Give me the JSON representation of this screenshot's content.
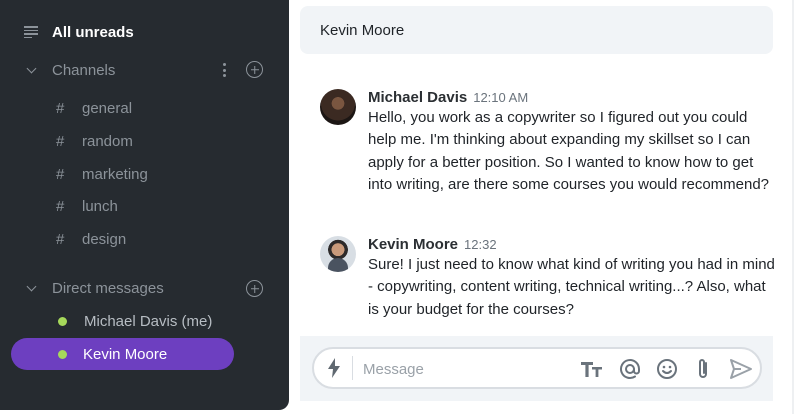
{
  "sidebar": {
    "all_unreads": "All unreads",
    "channels_header": "Channels",
    "channels": [
      {
        "label": "general"
      },
      {
        "label": "random"
      },
      {
        "label": "marketing"
      },
      {
        "label": "lunch"
      },
      {
        "label": "design"
      }
    ],
    "dm_header": "Direct messages",
    "direct_messages": [
      {
        "label": "Michael Davis (me)",
        "status": "online"
      },
      {
        "label": "Kevin Moore",
        "status": "online",
        "active": true
      }
    ],
    "hash": "#"
  },
  "header": {
    "title": "Kevin Moore"
  },
  "messages": [
    {
      "author": "Michael Davis",
      "time": "12:10 AM",
      "text": "Hello, you work as a copywriter so I figured out you could help me. I'm thinking about expanding my skillset so I can apply for a better position. So I wanted to know how to get into writing, are there some courses you would recommend?"
    },
    {
      "author": "Kevin Moore",
      "time": "12:32",
      "text": "Sure! I just need to know what kind of writing you had in mind - copywriting, content writing, technical writing...? Also, what is your budget for the courses?"
    }
  ],
  "composer": {
    "placeholder": "Message",
    "value": "",
    "tools": [
      "text-format-icon",
      "mention-icon",
      "emoji-icon",
      "attachment-icon",
      "send-icon"
    ]
  },
  "colors": {
    "sidebar_bg": "#262b30",
    "active_item": "#6d3fc0",
    "online_dot": "#a6d95b",
    "panel_bg": "#f1f4f7"
  }
}
